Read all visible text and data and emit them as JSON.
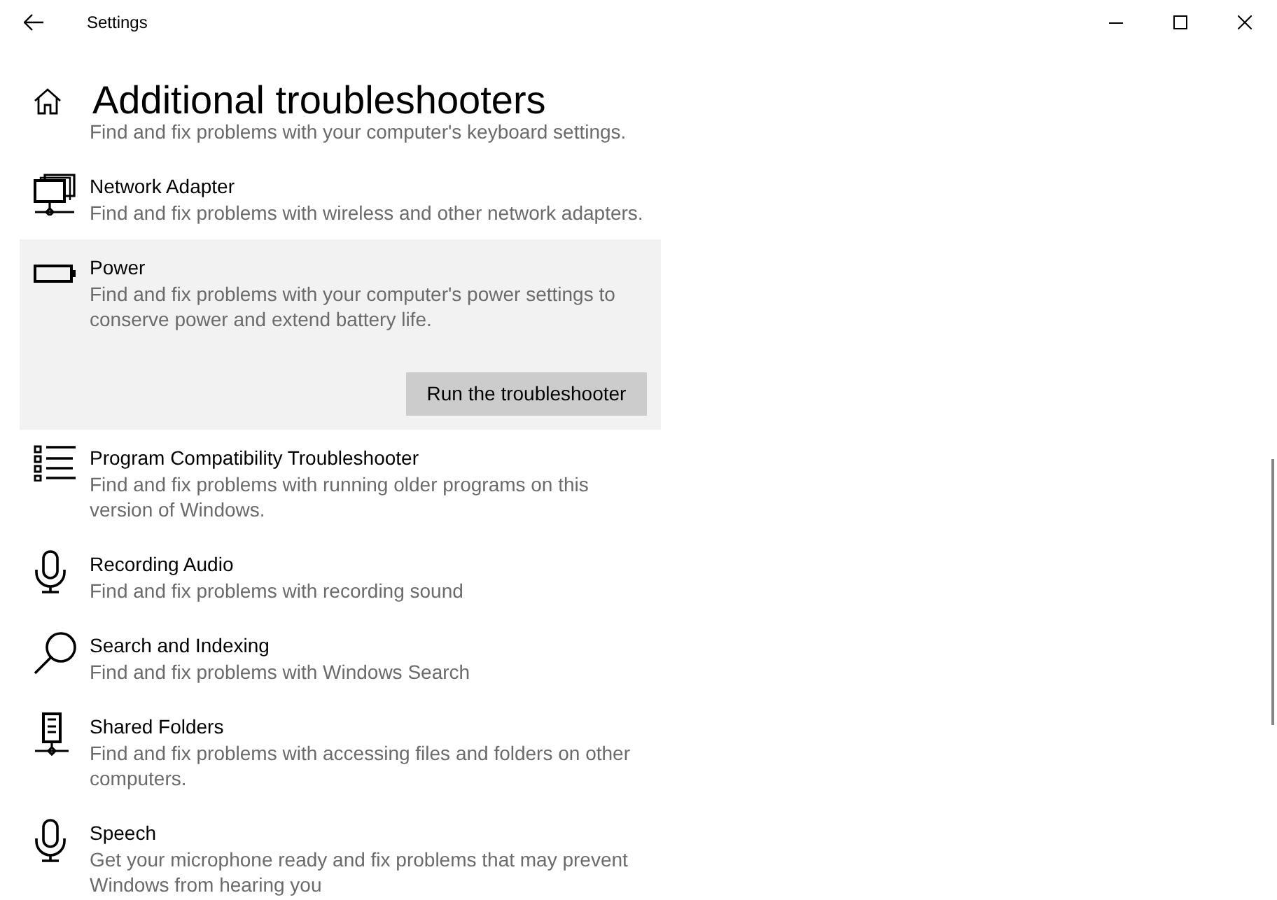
{
  "window": {
    "title": "Settings"
  },
  "page": {
    "title": "Additional troubleshooters"
  },
  "partial_item": {
    "description": "Find and fix problems with your computer's keyboard settings."
  },
  "troubleshooters": [
    {
      "title": "Network Adapter",
      "description": "Find and fix problems with wireless and other network adapters.",
      "expanded": false
    },
    {
      "title": "Power",
      "description": "Find and fix problems with your computer's power settings to conserve power and extend battery life.",
      "expanded": true,
      "action": "Run the troubleshooter"
    },
    {
      "title": "Program Compatibility Troubleshooter",
      "description": "Find and fix problems with running older programs on this version of Windows.",
      "expanded": false
    },
    {
      "title": "Recording Audio",
      "description": "Find and fix problems with recording sound",
      "expanded": false
    },
    {
      "title": "Search and Indexing",
      "description": "Find and fix problems with Windows Search",
      "expanded": false
    },
    {
      "title": "Shared Folders",
      "description": "Find and fix problems with accessing files and folders on other computers.",
      "expanded": false
    },
    {
      "title": "Speech",
      "description": "Get your microphone ready and fix problems that may prevent Windows from hearing you",
      "expanded": false
    }
  ]
}
